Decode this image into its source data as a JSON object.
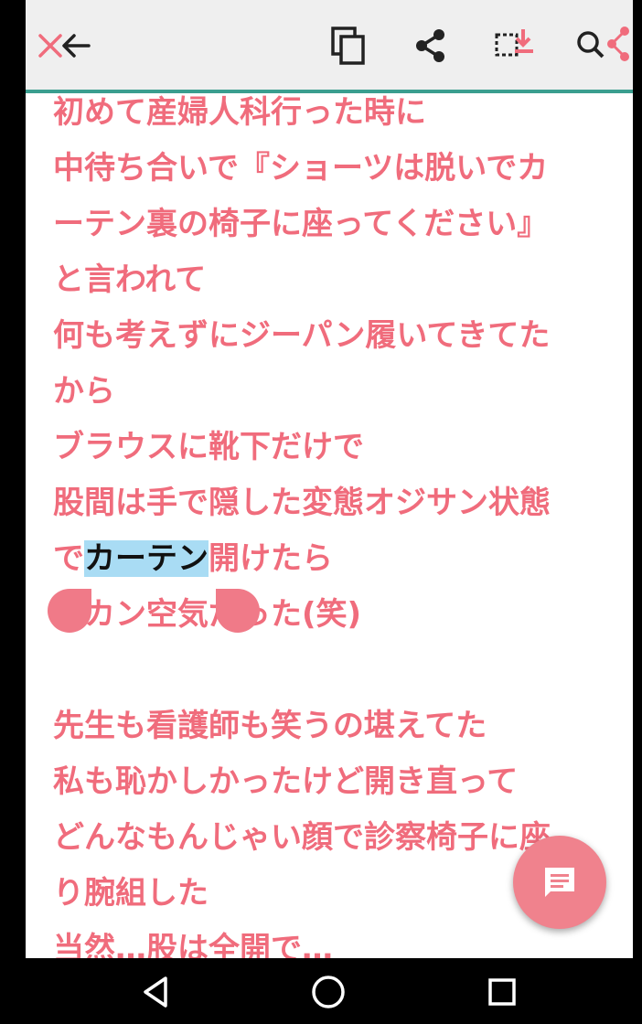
{
  "toolbar": {
    "icons": [
      "close-icon",
      "back-arrow-icon",
      "copy-icon",
      "share-icon",
      "save-selection-icon",
      "search-share-icon"
    ],
    "accent_color": "#3a9e8f",
    "close_color": "#f06c7c"
  },
  "content": {
    "text_color": "#f06c7c",
    "lines": [
      "初めて産婦人科行った時に",
      "中待ち合いで『ショーツは脱いでカ",
      "ーテン裏の椅子に座ってください』",
      "と言われて",
      "何も考えずにジーパン履いてきてた",
      "から",
      "ブラウスに靴下だけで",
      "股間は手で隠した変態オジサン状態"
    ],
    "selection_line": {
      "before": "で",
      "selected": "カーテン",
      "after": "開けたら"
    },
    "line_after_selection": "ポカン空気だった(笑)",
    "lines_after": [
      "先生も看護師も笑うの堪えてた",
      "私も恥かしかったけど開き直って",
      "どんなもんじゃい顔で診察椅子に座",
      "り腕組した",
      "当然…股は全開で…"
    ]
  },
  "fab": {
    "icon": "comment-icon",
    "color": "#f0828d"
  },
  "navbar": {
    "icons": [
      "back-triangle-icon",
      "home-circle-icon",
      "recents-square-icon"
    ]
  }
}
